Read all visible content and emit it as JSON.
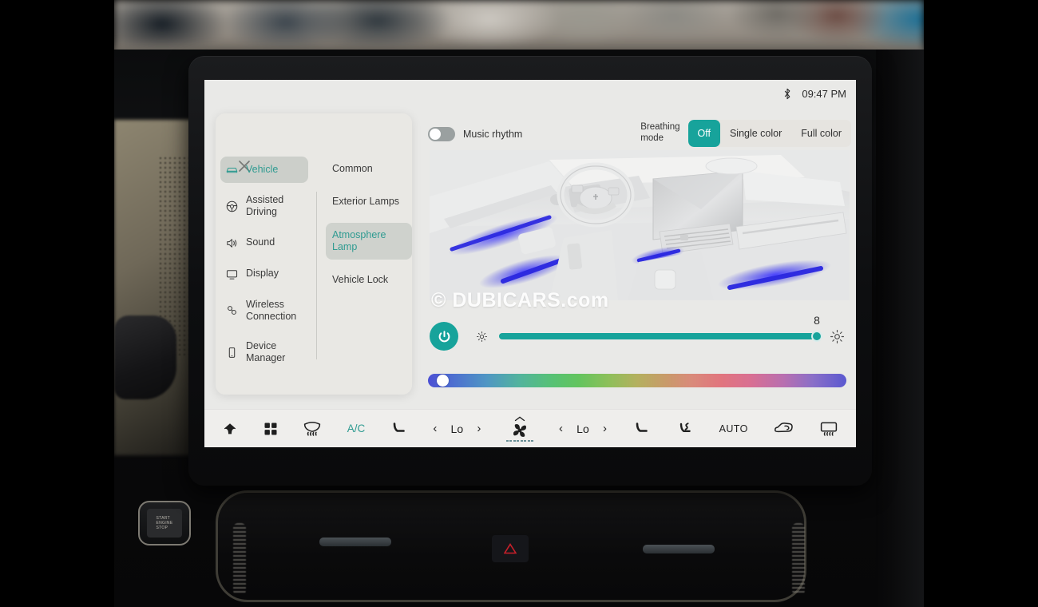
{
  "status_bar": {
    "bluetooth_icon": "bluetooth-icon",
    "time": "09:47 PM"
  },
  "settings_panel": {
    "close_icon": "close-icon",
    "nav_items": [
      {
        "label": "Vehicle",
        "icon": "car-icon",
        "active": true
      },
      {
        "label": "Assisted\nDriving",
        "icon": "steering-wheel-icon",
        "active": false
      },
      {
        "label": "Sound",
        "icon": "speaker-icon",
        "active": false
      },
      {
        "label": "Display",
        "icon": "monitor-icon",
        "active": false
      },
      {
        "label": "Wireless\nConnection",
        "icon": "link-icon",
        "active": false
      },
      {
        "label": "Device\nManager",
        "icon": "phone-icon",
        "active": false
      }
    ],
    "sub_items": [
      {
        "label": "Common",
        "active": false
      },
      {
        "label": "Exterior Lamps",
        "active": false
      },
      {
        "label": "Atmosphere\nLamp",
        "active": true
      },
      {
        "label": "Vehicle Lock",
        "active": false
      }
    ]
  },
  "atmosphere_lamp": {
    "music_rhythm": {
      "label": "Music rhythm",
      "enabled": false
    },
    "breathing_mode": {
      "label": "Breathing\nmode",
      "options": [
        "Off",
        "Single color",
        "Full color"
      ],
      "selected": "Off"
    },
    "brightness": {
      "power_icon": "power-icon",
      "min_icon": "sun-small-icon",
      "max_icon": "sun-large-icon",
      "value": 8,
      "min": 0,
      "max": 8
    },
    "color_slider": {
      "position_percent": 2
    },
    "watermark": "© DUBICARS.com"
  },
  "climate_bar": {
    "items": [
      {
        "name": "home-icon",
        "type": "icon",
        "label": ""
      },
      {
        "name": "apps-grid-icon",
        "type": "icon",
        "label": ""
      },
      {
        "name": "front-defrost-icon",
        "type": "icon",
        "label": ""
      },
      {
        "name": "ac-button",
        "type": "text",
        "label": "A/C",
        "accent": true
      },
      {
        "name": "driver-seat-heat-icon",
        "type": "icon",
        "label": ""
      },
      {
        "name": "driver-temp",
        "type": "stepper",
        "label": "Lo",
        "prev": "‹",
        "next": "›"
      },
      {
        "name": "fan-speed-icon",
        "type": "icon",
        "label": ""
      },
      {
        "name": "passenger-temp",
        "type": "stepper",
        "label": "Lo",
        "prev": "‹",
        "next": "›"
      },
      {
        "name": "passenger-seat-heat-icon",
        "type": "icon",
        "label": ""
      },
      {
        "name": "seat-ventilation-icon",
        "type": "icon",
        "label": ""
      },
      {
        "name": "auto-button",
        "type": "text",
        "label": "AUTO",
        "accent": false
      },
      {
        "name": "air-recirculation-icon",
        "type": "icon",
        "label": ""
      },
      {
        "name": "rear-defrost-icon",
        "type": "icon",
        "label": ""
      }
    ]
  },
  "dashboard": {
    "start_stop_label": "START\nENGINE\nSTOP",
    "hazard_icon": "hazard-triangle-icon"
  },
  "colors": {
    "accent": "#17a39b",
    "accent_text": "#2f9b91",
    "screen_bg": "#e9e9e7",
    "climate_bg": "#efeeec",
    "hazard_red": "#c8202a",
    "ambient_blue": "#2a27e0"
  }
}
